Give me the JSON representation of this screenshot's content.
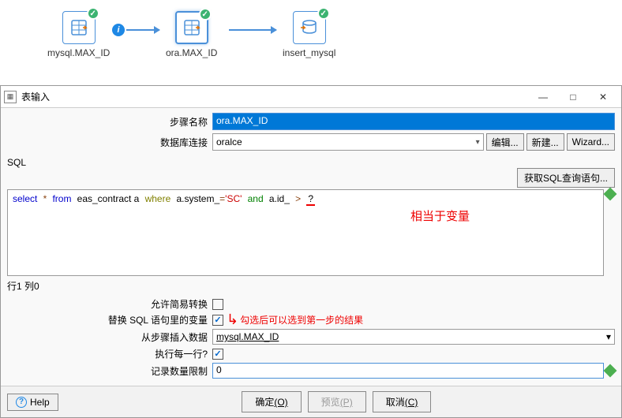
{
  "flow": {
    "nodes": [
      {
        "label": "mysql.MAX_ID"
      },
      {
        "label": "ora.MAX_ID"
      },
      {
        "label": "insert_mysql"
      }
    ]
  },
  "dialog": {
    "title": "表输入",
    "window_controls": {
      "min": "—",
      "max": "□",
      "close": "✕"
    },
    "step_name_label": "步骤名称",
    "step_name_value": "ora.MAX_ID",
    "db_label": "数据库连接",
    "db_value": "oralce",
    "db_buttons": {
      "edit": "编辑...",
      "new": "新建...",
      "wizard": "Wizard..."
    },
    "sql_label": "SQL",
    "sql_get_btn": "获取SQL查询语句...",
    "sql_tokens": {
      "select": "select",
      "star": "*",
      "from": "from",
      "table": "eas_contract a",
      "where": "where",
      "col1": "a.system_",
      "eq": "=",
      "val": "'SC'",
      "and": "and",
      "col2": "a.id_",
      "gt": ">",
      "qmark": "?"
    },
    "annotation1": "相当于变量",
    "pos_label": "行1 列0",
    "options": {
      "simple_conv_label": "允许简易转换",
      "simple_conv_checked": false,
      "replace_var_label": "替换 SQL 语句里的变量",
      "replace_var_checked": true,
      "annotation2": "勾选后可以选到第一步的结果",
      "insert_from_label": "从步骤插入数据",
      "insert_from_value": "mysql.MAX_ID",
      "exec_each_label": "执行每一行?",
      "exec_each_checked": true,
      "limit_label": "记录数量限制",
      "limit_value": "0"
    },
    "buttons": {
      "help": "Help",
      "ok": "确定",
      "ok_mnemonic": "(O)",
      "preview": "预览",
      "preview_mnemonic": "(P)",
      "cancel": "取消",
      "cancel_mnemonic": "(C)"
    }
  }
}
